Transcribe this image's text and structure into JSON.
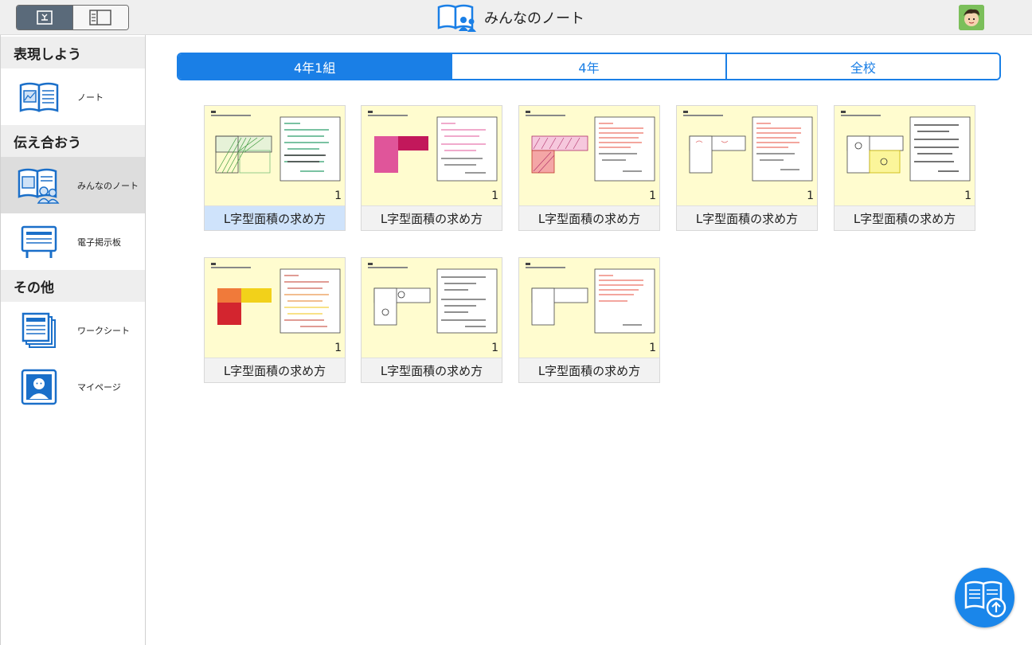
{
  "header": {
    "title": "みんなのノート"
  },
  "sidebar": {
    "sections": [
      {
        "heading": "表現しよう"
      },
      {
        "heading": "伝え合おう"
      },
      {
        "heading": "その他"
      }
    ],
    "items": [
      {
        "label": "ノート",
        "icon": "notebook-icon"
      },
      {
        "label": "みんなのノート",
        "icon": "shared-notebook-icon",
        "active": true
      },
      {
        "label": "電子掲示板",
        "icon": "bulletin-board-icon"
      },
      {
        "label": "ワークシート",
        "icon": "worksheet-icon"
      },
      {
        "label": "マイページ",
        "icon": "mypage-icon"
      }
    ]
  },
  "tabs": [
    {
      "label": "4年1組",
      "active": true
    },
    {
      "label": "4年"
    },
    {
      "label": "全校"
    }
  ],
  "cards": [
    {
      "caption": "L字型面積の求め方",
      "count": "1",
      "selected": true
    },
    {
      "caption": "L字型面積の求め方",
      "count": "1"
    },
    {
      "caption": "L字型面積の求め方",
      "count": "1"
    },
    {
      "caption": "L字型面積の求め方",
      "count": "1"
    },
    {
      "caption": "L字型面積の求め方",
      "count": "1"
    },
    {
      "caption": "L字型面積の求め方",
      "count": "1"
    },
    {
      "caption": "L字型面積の求め方",
      "count": "1"
    },
    {
      "caption": "L字型面積の求め方",
      "count": "1"
    }
  ],
  "colors": {
    "accent": "#1a7fe6",
    "thumb_bg": "#fffccf",
    "selected_caption": "#cfe3fb"
  },
  "fab": {
    "icon": "upload-notebook-icon"
  }
}
